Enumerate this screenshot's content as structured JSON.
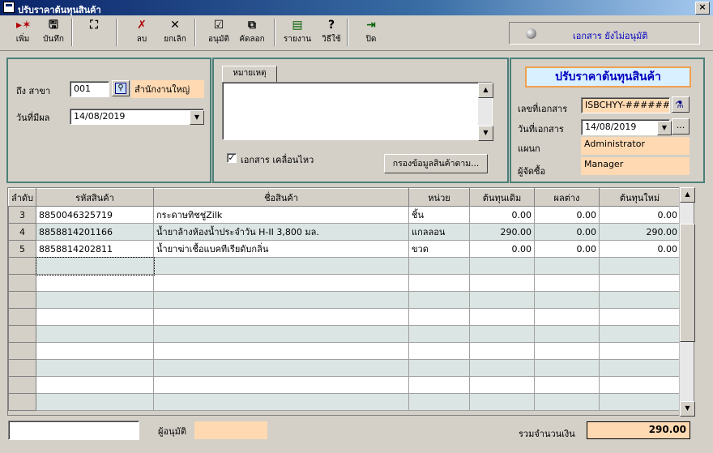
{
  "window": {
    "title": "ปรับราคาต้นทุนสินค้า",
    "close": "×"
  },
  "toolbar": {
    "buttons": [
      {
        "label": "เพิ่ม",
        "icon": "add-icon",
        "glyph": "▸✶",
        "color": "#b00000"
      },
      {
        "label": "บันทึก",
        "icon": "save-icon",
        "glyph": "🖫",
        "color": "#000000"
      },
      {
        "label": "",
        "icon": "find-icon",
        "glyph": "⛶",
        "color": "#000000"
      },
      {
        "label": "ลบ",
        "icon": "delete-icon",
        "glyph": "✗",
        "color": "#b00000"
      },
      {
        "label": "ยกเลิก",
        "icon": "cancel-icon",
        "glyph": "✕",
        "color": "#000000"
      },
      {
        "label": "อนุมัติ",
        "icon": "approve-icon",
        "glyph": "☑",
        "color": "#000000"
      },
      {
        "label": "คัดลอก",
        "icon": "copy-icon",
        "glyph": "⧉",
        "color": "#000000"
      },
      {
        "label": "รายงาน",
        "icon": "report-icon",
        "glyph": "▤",
        "color": "#006000"
      },
      {
        "label": "วิธีใช้",
        "icon": "help-icon",
        "glyph": "?",
        "color": "#000000"
      },
      {
        "label": "ปิด",
        "icon": "exit-icon",
        "glyph": "⇥",
        "color": "#006000"
      }
    ],
    "status_text": "เอกสาร ยังไม่อนุมัติ"
  },
  "left_panel": {
    "branch_label": "ถึง สาขา",
    "branch_code": "001",
    "branch_name": "สำนักงานใหญ่",
    "effective_date_label": "วันที่มีผล",
    "effective_date": "14/08/2019"
  },
  "notes_panel": {
    "tab_label": "หมายเหตุ",
    "notes_value": "",
    "moving_doc_label": "เอกสาร เคลื่อนไหว",
    "moving_doc_checked": true,
    "filter_button": "กรองข้อมูลสินค้าตาม..."
  },
  "doc_panel": {
    "heading": "ปรับราคาต้นทุนสินค้า",
    "doc_no_label": "เลขที่เอกสาร",
    "doc_no": "ISBCHYY-######",
    "doc_date_label": "วันที่เอกสาร",
    "doc_date": "14/08/2019",
    "dept_label": "แผนก",
    "dept_value": "Administrator",
    "buyer_label": "ผู้จัดซื้อ",
    "buyer_value": "Manager"
  },
  "grid": {
    "columns": [
      "ลำดับ",
      "รหัสสินค้า",
      "ชื่อสินค้า",
      "หน่วย",
      "ต้นทุนเดิม",
      "ผลต่าง",
      "ต้นทุนใหม่"
    ],
    "rows": [
      [
        "3",
        "8850046325719",
        "กระดาษทิชชู่Zilk",
        "ชิ้น",
        "0.00",
        "0.00",
        "0.00"
      ],
      [
        "4",
        "8858814201166",
        "น้ำยาล้างห้องน้ำประจำวัน H-II 3,800 มล.",
        "แกลลอน",
        "290.00",
        "0.00",
        "290.00"
      ],
      [
        "5",
        "8858814202811",
        "น้ำยาฆ่าเชื้อแบคทีเรียดับกลิ่น",
        "ขวด",
        "0.00",
        "0.00",
        "0.00"
      ],
      [
        "",
        "",
        "",
        "",
        "",
        "",
        ""
      ],
      [
        "",
        "",
        "",
        "",
        "",
        "",
        ""
      ],
      [
        "",
        "",
        "",
        "",
        "",
        "",
        ""
      ],
      [
        "",
        "",
        "",
        "",
        "",
        "",
        ""
      ],
      [
        "",
        "",
        "",
        "",
        "",
        "",
        ""
      ],
      [
        "",
        "",
        "",
        "",
        "",
        "",
        ""
      ],
      [
        "",
        "",
        "",
        "",
        "",
        "",
        ""
      ],
      [
        "",
        "",
        "",
        "",
        "",
        "",
        ""
      ],
      [
        "",
        "",
        "",
        "",
        "",
        "",
        ""
      ]
    ]
  },
  "footer": {
    "left_input_value": "",
    "approver_label": "ผู้อนุมัติ",
    "approver_value": "",
    "total_label": "รวมจำนวนเงิน",
    "total_value": "290.00"
  }
}
